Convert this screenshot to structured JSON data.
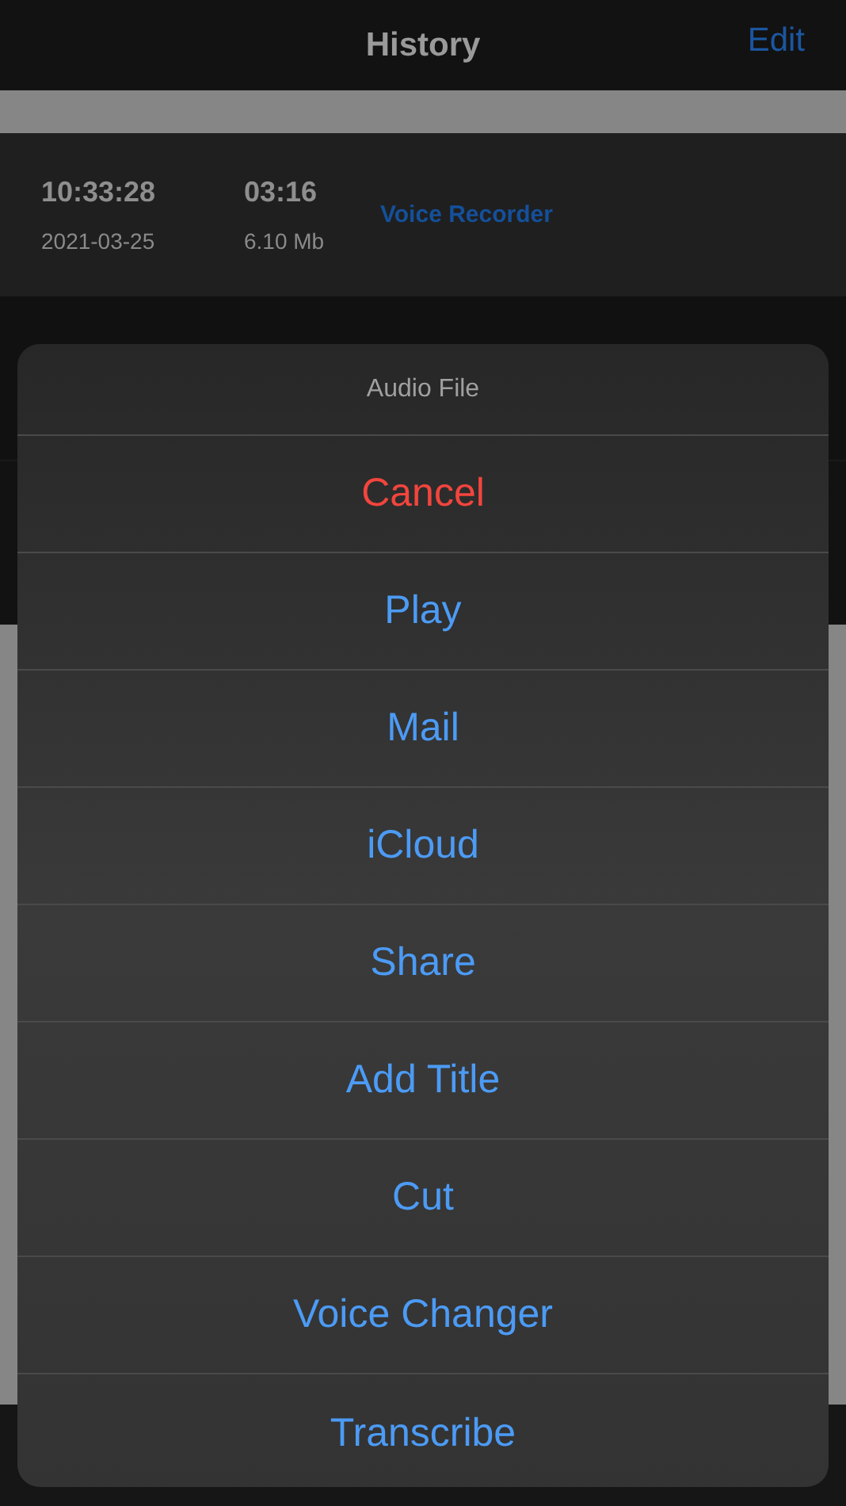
{
  "nav": {
    "title": "History",
    "edit": "Edit"
  },
  "recordings": [
    {
      "time": "10:33:28",
      "duration": "03:16",
      "date": "2021-03-25",
      "size": "6.10 Mb",
      "source": "Voice Recorder"
    }
  ],
  "sheet": {
    "title": "Audio File",
    "actions": [
      {
        "label": "Cancel",
        "kind": "cancel"
      },
      {
        "label": "Play",
        "kind": "default"
      },
      {
        "label": "Mail",
        "kind": "default"
      },
      {
        "label": "iCloud",
        "kind": "default"
      },
      {
        "label": "Share",
        "kind": "default"
      },
      {
        "label": "Add Title",
        "kind": "default"
      },
      {
        "label": "Cut",
        "kind": "default"
      },
      {
        "label": "Voice Changer",
        "kind": "default"
      },
      {
        "label": "Transcribe",
        "kind": "default"
      }
    ]
  }
}
